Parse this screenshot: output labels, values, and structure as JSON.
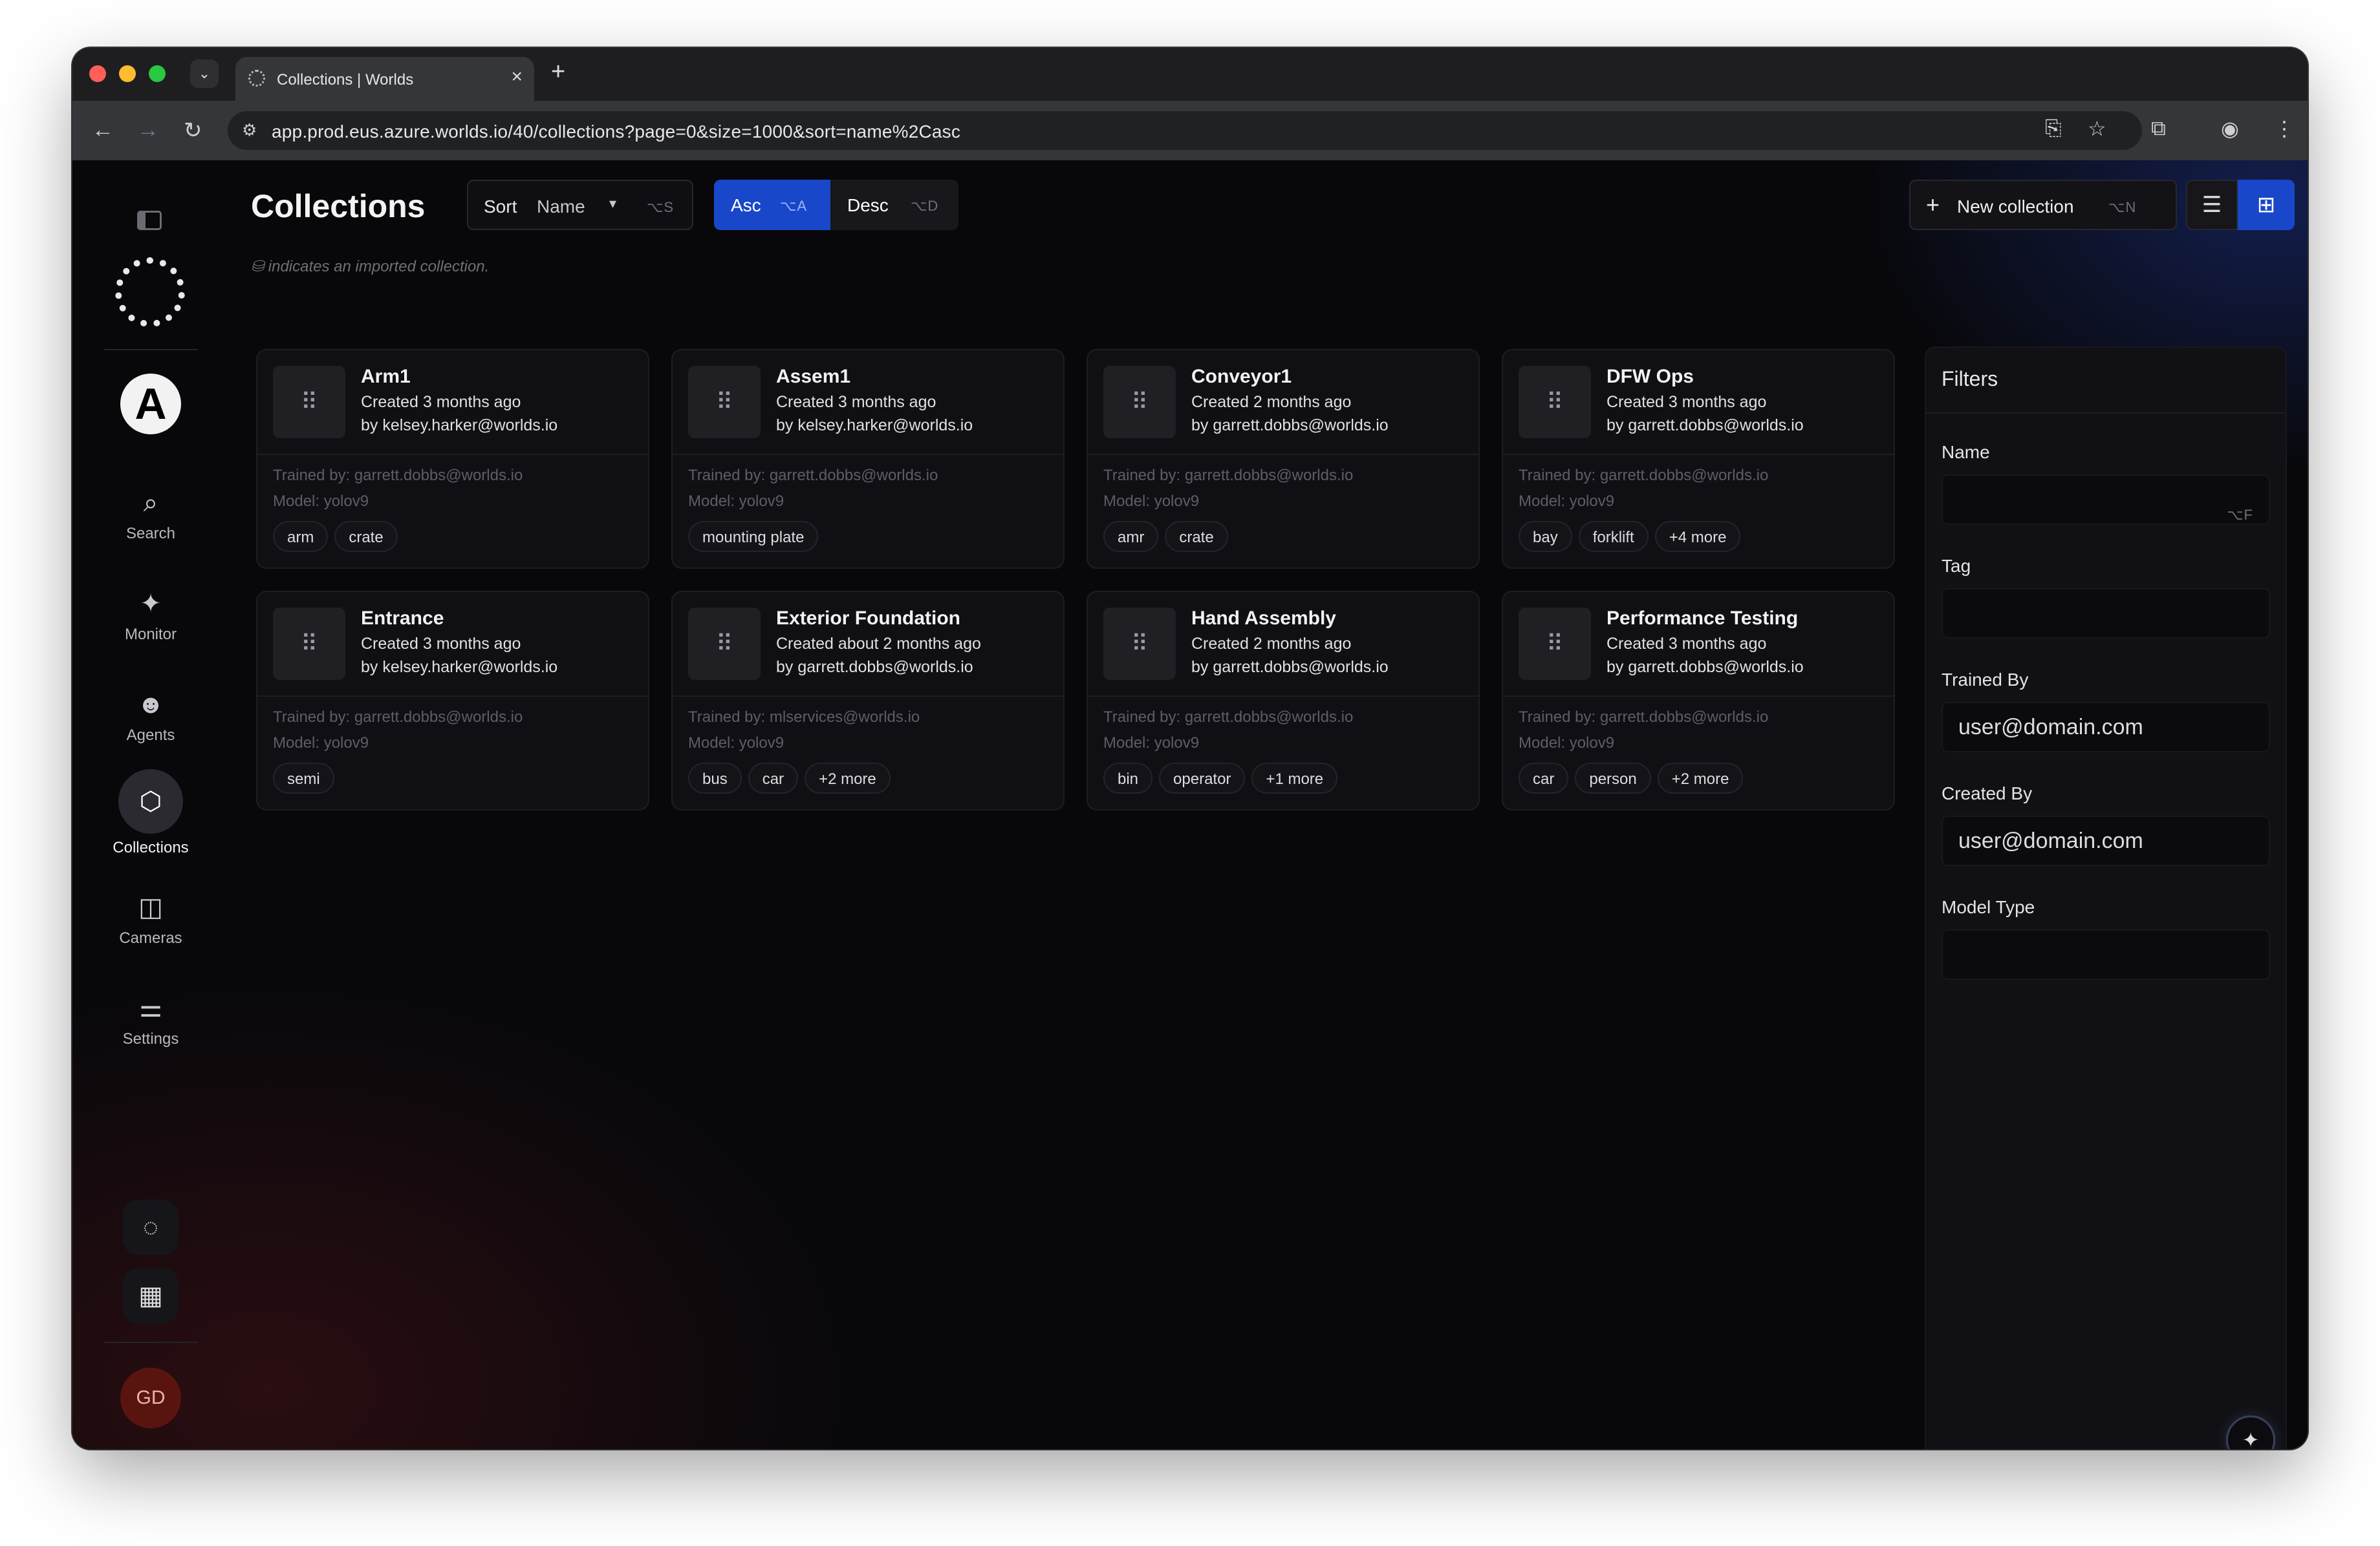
{
  "browser": {
    "tab_title": "Collections | Worlds",
    "url": "app.prod.eus.azure.worlds.io/40/collections?page=0&size=1000&sort=name%2Casc"
  },
  "sidebar": {
    "org_initial": "A",
    "items": [
      {
        "label": "Search",
        "icon": "search-icon"
      },
      {
        "label": "Monitor",
        "icon": "monitor-icon"
      },
      {
        "label": "Agents",
        "icon": "agents-icon"
      },
      {
        "label": "Collections",
        "icon": "collections-icon",
        "active": true
      },
      {
        "label": "Cameras",
        "icon": "cameras-icon"
      },
      {
        "label": "Settings",
        "icon": "settings-icon"
      }
    ],
    "user_initials": "GD"
  },
  "header": {
    "title": "Collections",
    "sort_label": "Sort",
    "sort_value": "Name",
    "sort_kbd": "⌥S",
    "asc_label": "Asc",
    "asc_kbd": "⌥A",
    "desc_label": "Desc",
    "desc_kbd": "⌥D",
    "new_label": "New collection",
    "new_kbd": "⌥N",
    "hint": "indicates an imported collection."
  },
  "collections": [
    {
      "name": "Arm1",
      "created": "Created 3 months ago",
      "by": "by kelsey.harker@worlds.io",
      "trained_by": "Trained by: garrett.dobbs@worlds.io",
      "model": "Model: yolov9",
      "tags": [
        "arm",
        "crate"
      ]
    },
    {
      "name": "Assem1",
      "created": "Created 3 months ago",
      "by": "by kelsey.harker@worlds.io",
      "trained_by": "Trained by: garrett.dobbs@worlds.io",
      "model": "Model: yolov9",
      "tags": [
        "mounting plate"
      ]
    },
    {
      "name": "Conveyor1",
      "created": "Created 2 months ago",
      "by": "by garrett.dobbs@worlds.io",
      "trained_by": "Trained by: garrett.dobbs@worlds.io",
      "model": "Model: yolov9",
      "tags": [
        "amr",
        "crate"
      ]
    },
    {
      "name": "DFW Ops",
      "created": "Created 3 months ago",
      "by": "by garrett.dobbs@worlds.io",
      "trained_by": "Trained by: garrett.dobbs@worlds.io",
      "model": "Model: yolov9",
      "tags": [
        "bay",
        "forklift",
        "+4 more"
      ]
    },
    {
      "name": "Entrance",
      "created": "Created 3 months ago",
      "by": "by kelsey.harker@worlds.io",
      "trained_by": "Trained by: garrett.dobbs@worlds.io",
      "model": "Model: yolov9",
      "tags": [
        "semi"
      ]
    },
    {
      "name": "Exterior Foundation",
      "created": "Created about 2 months ago",
      "by": "by garrett.dobbs@worlds.io",
      "trained_by": "Trained by: mlservices@worlds.io",
      "model": "Model: yolov9",
      "tags": [
        "bus",
        "car",
        "+2 more"
      ]
    },
    {
      "name": "Hand Assembly",
      "created": "Created 2 months ago",
      "by": "by garrett.dobbs@worlds.io",
      "trained_by": "Trained by: garrett.dobbs@worlds.io",
      "model": "Model: yolov9",
      "tags": [
        "bin",
        "operator",
        "+1 more"
      ]
    },
    {
      "name": "Performance Testing",
      "created": "Created 3 months ago",
      "by": "by garrett.dobbs@worlds.io",
      "trained_by": "Trained by: garrett.dobbs@worlds.io",
      "model": "Model: yolov9",
      "tags": [
        "car",
        "person",
        "+2 more"
      ]
    }
  ],
  "filters": {
    "title": "Filters",
    "name_label": "Name",
    "name_value": "",
    "name_kbd": "⌥F",
    "tag_label": "Tag",
    "tag_value": "",
    "trained_by_label": "Trained By",
    "trained_by_value": "user@domain.com",
    "created_by_label": "Created By",
    "created_by_value": "user@domain.com",
    "model_type_label": "Model Type",
    "model_type_value": ""
  },
  "colors": {
    "accent": "#1847c9",
    "background": "#08080b"
  }
}
